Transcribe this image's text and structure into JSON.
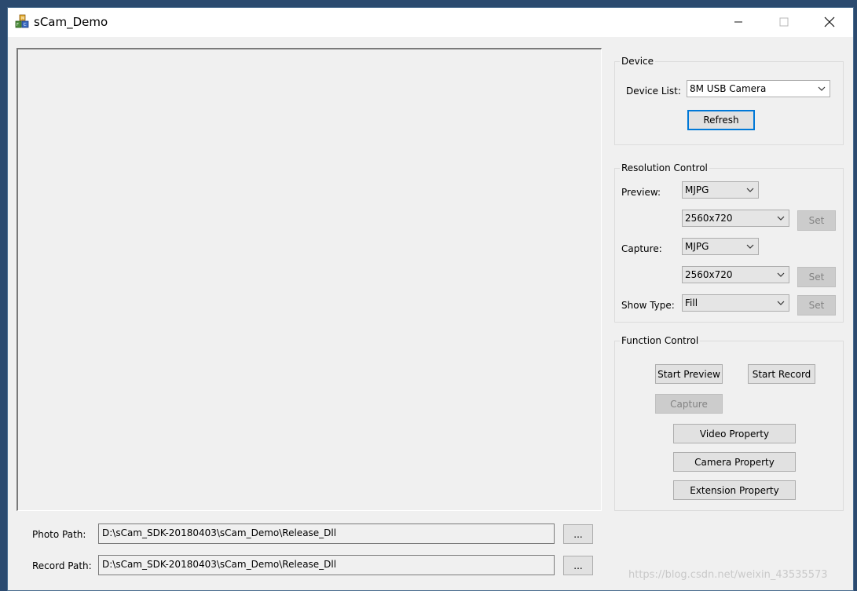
{
  "window": {
    "title": "sCam_Demo",
    "controls": {
      "minimize": "minimize-icon",
      "maximize": "maximize-icon",
      "close": "close-icon"
    }
  },
  "device": {
    "group_title": "Device",
    "list_label": "Device List:",
    "selected": "8M USB Camera",
    "refresh_label": "Refresh"
  },
  "resolution": {
    "group_title": "Resolution Control",
    "preview_label": "Preview:",
    "preview_format": "MJPG",
    "preview_size": "2560x720",
    "capture_label": "Capture:",
    "capture_format": "MJPG",
    "capture_size": "2560x720",
    "showtype_label": "Show Type:",
    "showtype": "Fill",
    "set_label": "Set"
  },
  "function": {
    "group_title": "Function Control",
    "start_preview": "Start Preview",
    "start_record": "Start Record",
    "capture": "Capture",
    "video_property": "Video Property",
    "camera_property": "Camera Property",
    "extension_property": "Extension Property"
  },
  "paths": {
    "photo_label": "Photo Path:",
    "photo_value": "D:\\sCam_SDK-20180403\\sCam_Demo\\Release_Dll",
    "record_label": "Record Path:",
    "record_value": "D:\\sCam_SDK-20180403\\sCam_Demo\\Release_Dll",
    "browse_label": "..."
  },
  "watermark": "https://blog.csdn.net/weixin_43535573",
  "colors": {
    "accent": "#0078d7",
    "window_bg": "#f0f0f0",
    "disabled_text": "#838383"
  }
}
